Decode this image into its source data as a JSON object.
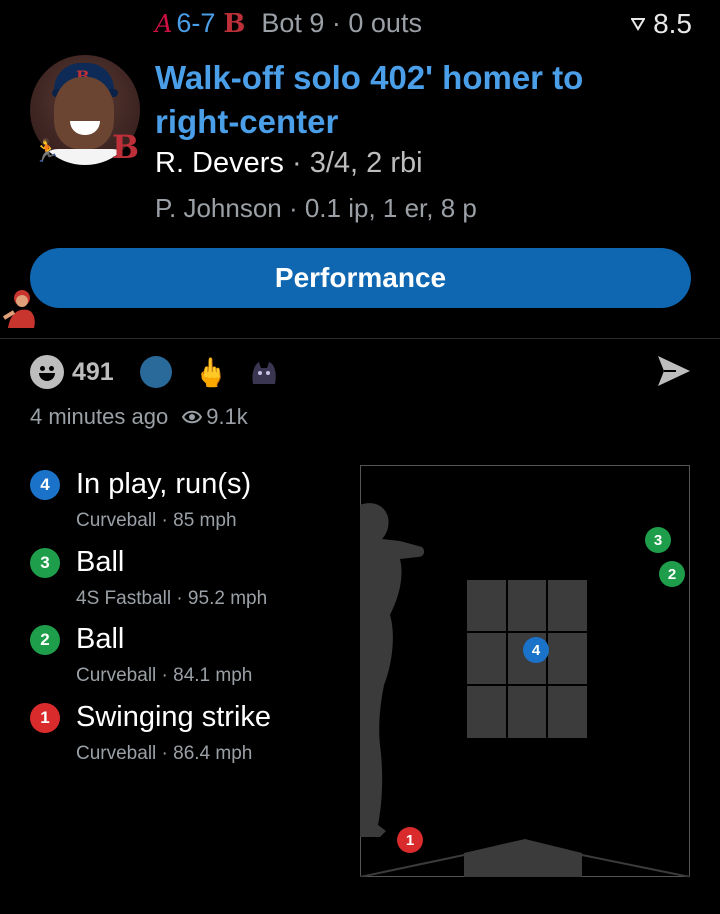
{
  "header": {
    "away_team_logo": "A",
    "score": "6-7",
    "home_team_logo": "B",
    "inning_state": "Bot 9 · 0 outs",
    "rating": "8.5",
    "team_logo_small": "B"
  },
  "play": {
    "headline": "Walk-off solo 402' homer to right-center",
    "batter_name": "R. Devers",
    "batter_sep": " · ",
    "batter_stats": "3/4, 2 rbi",
    "pitcher_line": "P. Johnson · 0.1 ip, 1 er, 8 p"
  },
  "performance_button": "Performance",
  "reactions": {
    "count": "491",
    "time_ago": "4 minutes ago",
    "views": "9.1k"
  },
  "pitches": [
    {
      "num": "4",
      "result": "In play, run(s)",
      "detail": "Curveball · 85 mph",
      "color": "#1a73c9"
    },
    {
      "num": "3",
      "result": "Ball",
      "detail": "4S Fastball · 95.2 mph",
      "color": "#1e9e4a"
    },
    {
      "num": "2",
      "result": "Ball",
      "detail": "Curveball · 84.1 mph",
      "color": "#1e9e4a"
    },
    {
      "num": "1",
      "result": "Swinging strike",
      "detail": "Curveball · 86.4 mph",
      "color": "#d92b2b"
    }
  ],
  "icons": {
    "odds": "signal-icon",
    "share": "send-icon",
    "views": "eye-icon",
    "reaction": "smiley-icon"
  }
}
